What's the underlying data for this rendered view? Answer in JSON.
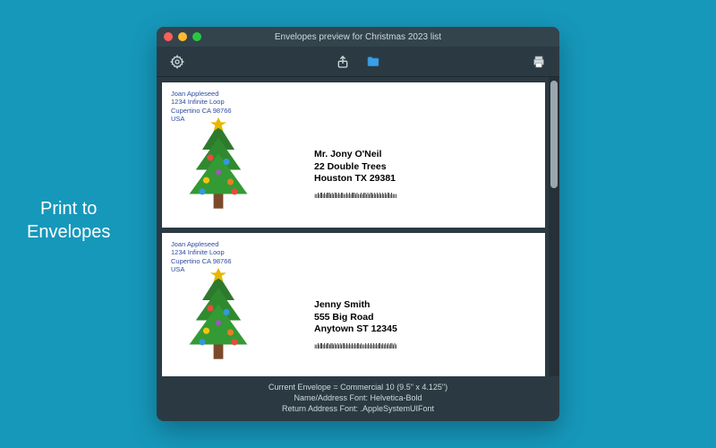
{
  "promo": {
    "line1": "Print to",
    "line2": "Envelopes"
  },
  "window": {
    "title": "Envelopes preview for Christmas 2023 list"
  },
  "toolbar": {
    "settings": "Settings",
    "share": "Share",
    "folder": "Folder",
    "print": "Print"
  },
  "return_address": {
    "name": "Joan Appleseed",
    "street": "1234 Infinite Loop",
    "city": "Cupertino CA 98766",
    "country": "USA"
  },
  "envelopes": [
    {
      "name": "Mr. Jony O'Neil",
      "street": "22 Double Trees",
      "city": "Houston TX 29381",
      "barcode": "ıılıllılılllılıllılıllıılılılllılıılıllılıllılılılılılıllılııı"
    },
    {
      "name": "Jenny Smith",
      "street": "555 Big Road",
      "city": "Anytown ST 12345",
      "barcode": "ıılıllılıllıllılılılıllılılılılıllılıılılılılılıllılılılıllılı"
    }
  ],
  "footer": {
    "envelope": "Current Envelope  = Commercial 10 (9.5\" x 4.125\")",
    "name_font": "Name/Address Font: Helvetica-Bold",
    "return_font": "Return Address Font: .AppleSystemUIFont"
  },
  "colors": {
    "accent": "#1698bb",
    "window": "#2b3a42"
  }
}
